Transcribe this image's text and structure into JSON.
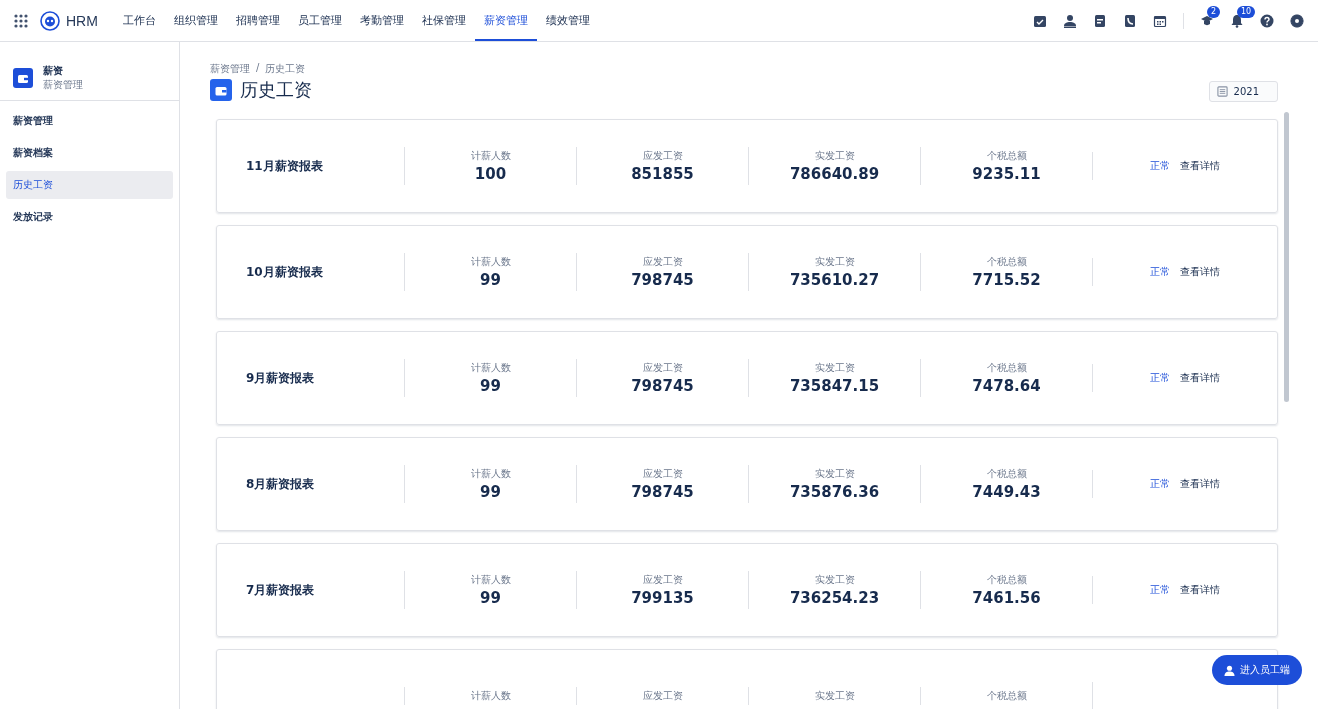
{
  "topbar": {
    "brand": "HRM",
    "nav": [
      {
        "label": "工作台",
        "selected": false
      },
      {
        "label": "组织管理",
        "selected": false
      },
      {
        "label": "招聘管理",
        "selected": false
      },
      {
        "label": "员工管理",
        "selected": false
      },
      {
        "label": "考勤管理",
        "selected": false
      },
      {
        "label": "社保管理",
        "selected": false
      },
      {
        "label": "薪资管理",
        "selected": true
      },
      {
        "label": "绩效管理",
        "selected": false
      }
    ],
    "badges": {
      "approvals": "2",
      "notifications": "10"
    }
  },
  "sidebar": {
    "title": "薪资",
    "subtitle": "薪资管理",
    "items": [
      {
        "label": "薪资管理",
        "selected": false
      },
      {
        "label": "薪资档案",
        "selected": false
      },
      {
        "label": "历史工资",
        "selected": true
      },
      {
        "label": "发放记录",
        "selected": false
      }
    ]
  },
  "breadcrumb": {
    "items": [
      "薪资管理",
      "历史工资"
    ],
    "separator": "/"
  },
  "page_title": "历史工资",
  "year_picker": {
    "value": "2021"
  },
  "reports": [
    {
      "title": "11月薪资报表",
      "stats": [
        {
          "label": "计薪人数",
          "value": "100"
        },
        {
          "label": "应发工资",
          "value": "851855"
        },
        {
          "label": "实发工资",
          "value": "786640.89"
        },
        {
          "label": "个税总额",
          "value": "9235.11"
        }
      ],
      "status": "正常",
      "action": "查看详情"
    },
    {
      "title": "10月薪资报表",
      "stats": [
        {
          "label": "计薪人数",
          "value": "99"
        },
        {
          "label": "应发工资",
          "value": "798745"
        },
        {
          "label": "实发工资",
          "value": "735610.27"
        },
        {
          "label": "个税总额",
          "value": "7715.52"
        }
      ],
      "status": "正常",
      "action": "查看详情"
    },
    {
      "title": "9月薪资报表",
      "stats": [
        {
          "label": "计薪人数",
          "value": "99"
        },
        {
          "label": "应发工资",
          "value": "798745"
        },
        {
          "label": "实发工资",
          "value": "735847.15"
        },
        {
          "label": "个税总额",
          "value": "7478.64"
        }
      ],
      "status": "正常",
      "action": "查看详情"
    },
    {
      "title": "8月薪资报表",
      "stats": [
        {
          "label": "计薪人数",
          "value": "99"
        },
        {
          "label": "应发工资",
          "value": "798745"
        },
        {
          "label": "实发工资",
          "value": "735876.36"
        },
        {
          "label": "个税总额",
          "value": "7449.43"
        }
      ],
      "status": "正常",
      "action": "查看详情"
    },
    {
      "title": "7月薪资报表",
      "stats": [
        {
          "label": "计薪人数",
          "value": "99"
        },
        {
          "label": "应发工资",
          "value": "799135"
        },
        {
          "label": "实发工资",
          "value": "736254.23"
        },
        {
          "label": "个税总额",
          "value": "7461.56"
        }
      ],
      "status": "正常",
      "action": "查看详情"
    },
    {
      "stats": [
        {
          "label": "计薪人数"
        },
        {
          "label": "应发工资"
        },
        {
          "label": "实发工资"
        },
        {
          "label": "个税总额"
        }
      ]
    }
  ],
  "employee_portal_button": "进入员工端"
}
